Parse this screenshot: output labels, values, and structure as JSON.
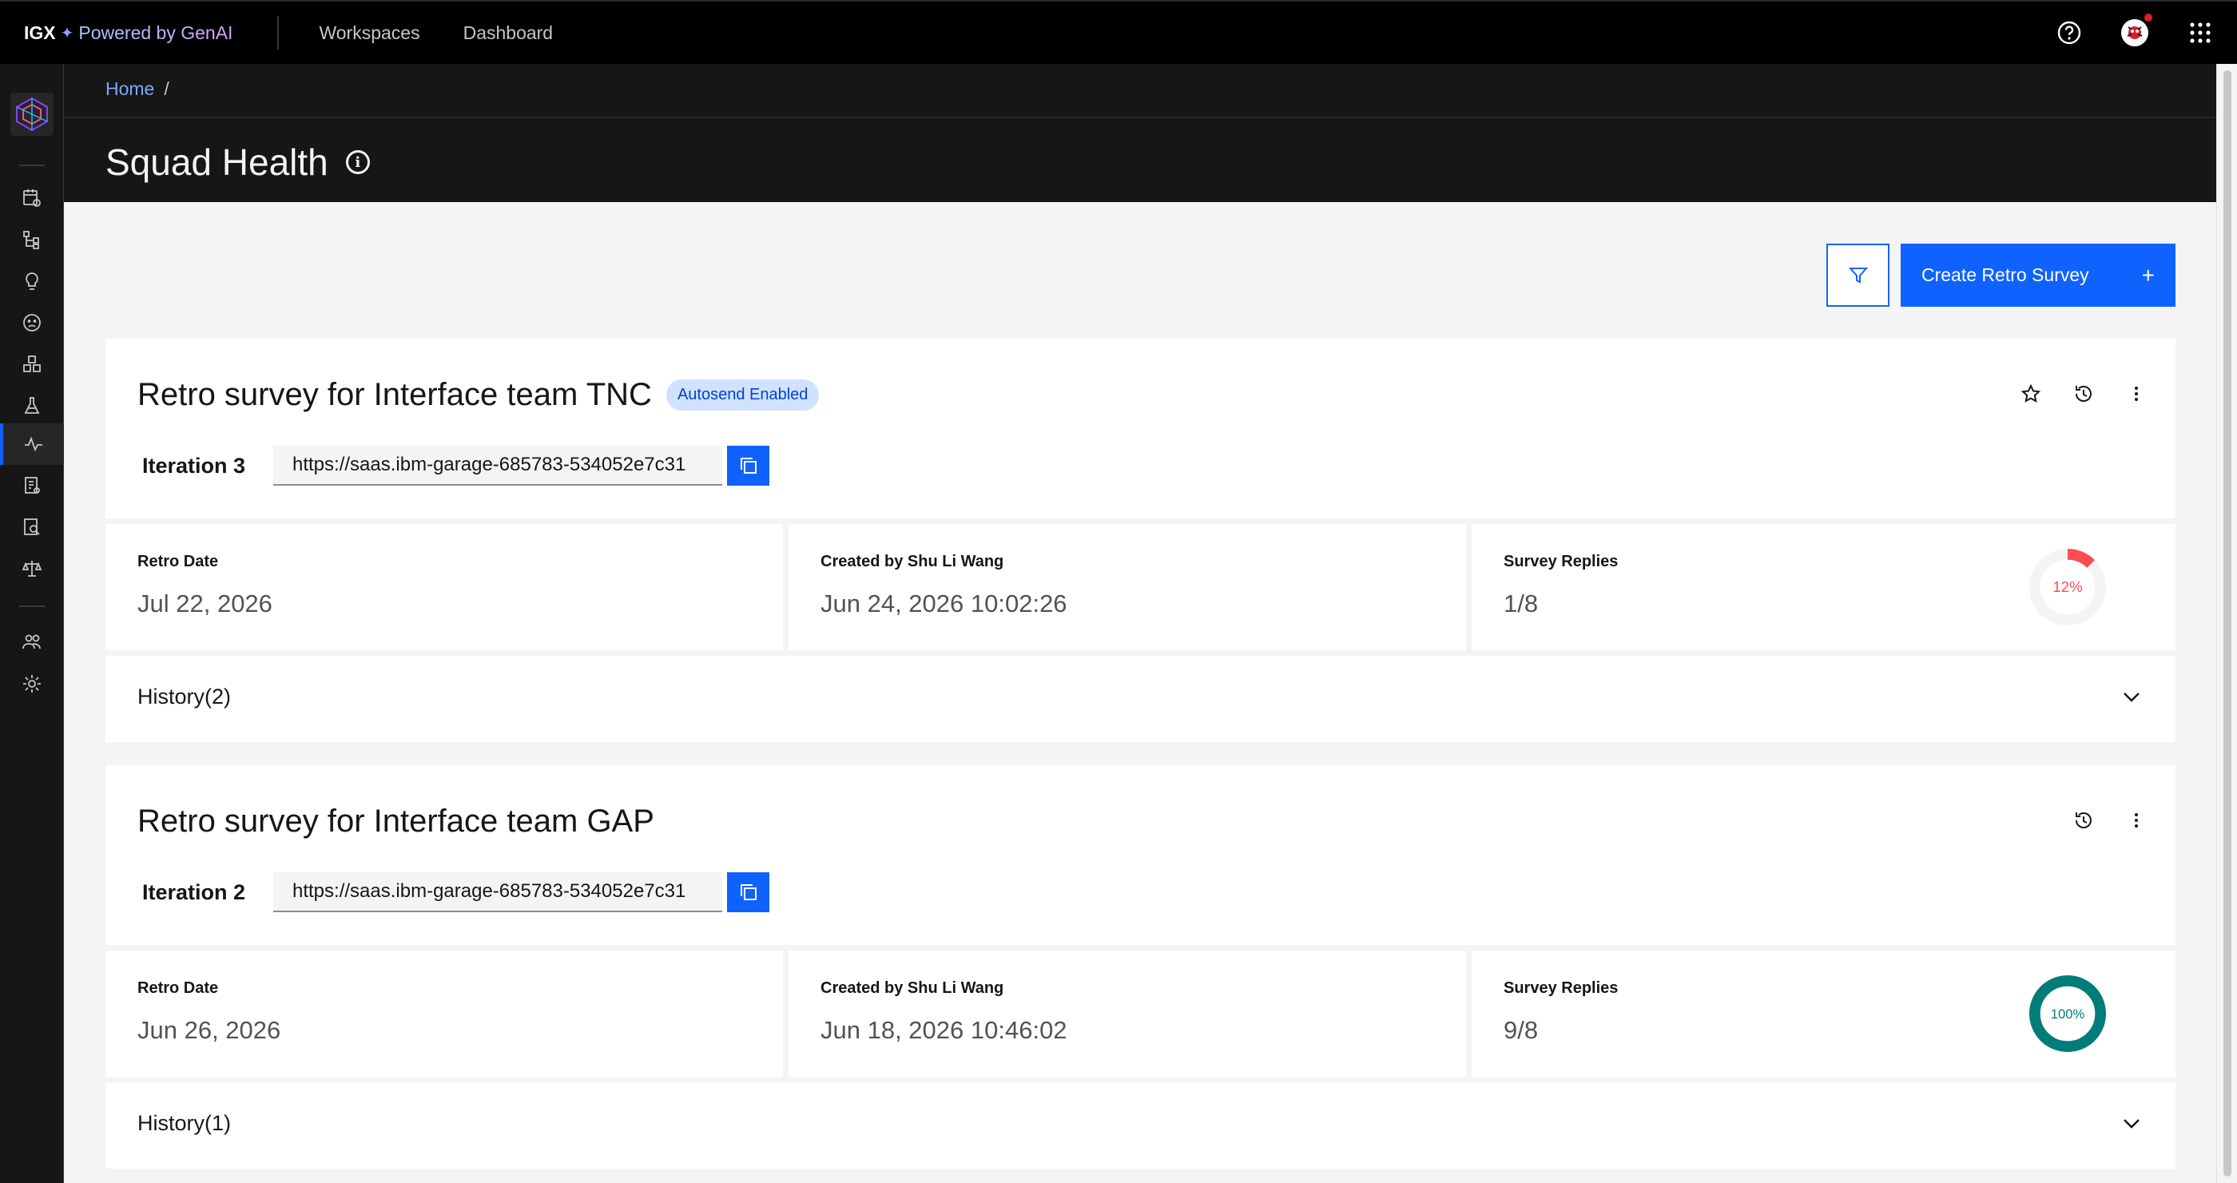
{
  "topbar": {
    "brand_igx": "IGX",
    "brand_spark": "✦",
    "brand_powered": "Powered by GenAI",
    "nav": [
      "Workspaces",
      "Dashboard"
    ]
  },
  "breadcrumb": {
    "home": "Home",
    "separator": "/"
  },
  "page": {
    "title": "Squad Health",
    "info_glyph": "i"
  },
  "toolbar": {
    "create_label": "Create Retro Survey",
    "create_plus": "+"
  },
  "surveys": [
    {
      "title": "Retro survey for Interface team TNC",
      "tag": "Autosend Enabled",
      "iteration": "Iteration 3",
      "url": "https://saas.ibm-garage-685783-534052e7c31",
      "retro_date_label": "Retro Date",
      "retro_date": "Jul 22, 2026",
      "created_label": "Created by Shu Li Wang",
      "created": "Jun 24, 2026 10:02:26",
      "replies_label": "Survey Replies",
      "replies": "1/8",
      "replies_pct_text": "12%",
      "replies_fraction": 0.125,
      "ring_color": "#fa4d56",
      "history": "History(2)"
    },
    {
      "title": "Retro survey for Interface team GAP",
      "tag": "",
      "iteration": "Iteration 2",
      "url": "https://saas.ibm-garage-685783-534052e7c31",
      "retro_date_label": "Retro Date",
      "retro_date": "Jun 26, 2026",
      "created_label": "Created by Shu Li Wang",
      "created": "Jun 18, 2026 10:46:02",
      "replies_label": "Survey Replies",
      "replies": "9/8",
      "replies_pct_text": "100%",
      "replies_fraction": 1.0,
      "ring_color": "#007d79",
      "history": "History(1)"
    }
  ],
  "colors": {
    "accent": "#0f62fe",
    "topbar": "#000000",
    "rail": "#161616"
  }
}
